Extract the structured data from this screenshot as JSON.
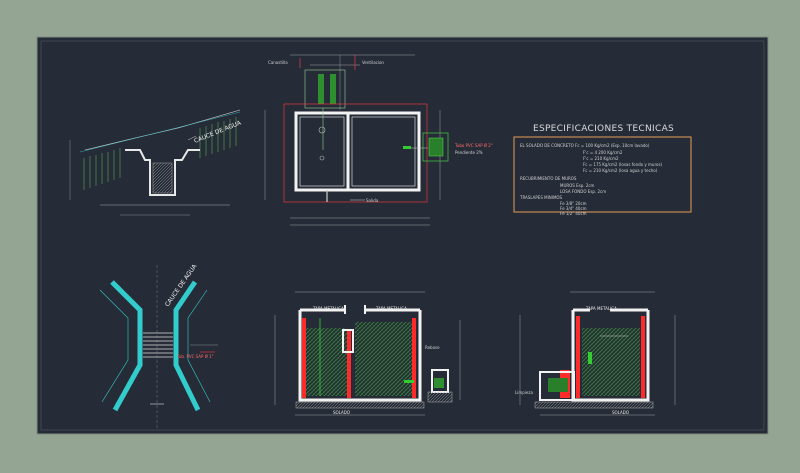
{
  "spec": {
    "title": "ESPECIFICACIONES TECNICAS",
    "rows": [
      "EL SOLADO DE CONCRETO   Fc = 100  Kg/cm2 (Esp. 10cm lavado)",
      "F'c = 4 200  Kg/cm2",
      "F'c = 210   Kg/cm2",
      "Fc = 175  Kg/cm2 (losas fondo y muros)",
      "Fc = 210  Kg/cm2 (losa agua y techo)",
      "RECUBRIMIENTO DE MUROS",
      "MUROS      Esp. 2cm",
      "LOSA FONDO  Esp. 2cm",
      "TRASLAPES MINIMOS",
      "Fe  3/8\"   20cm",
      "Fe  3/4\"   40cm",
      "Fe  1/2\"   40cm"
    ]
  },
  "cauce_label_top": "CAUCE DE AGUA",
  "cauce_label_bottom": "CAUCE DE AGUA",
  "solado_label": "SOLADO",
  "tapa_label": "TAPA METALICA",
  "section_notes": {
    "note1": "Tubo PVC SAP Ø 2\"",
    "note2": "Pendiente 2%",
    "note3": "Canastilla",
    "note4": "Tub. PVC SAP Ø 1\"",
    "note5": "Ventilacion",
    "note6": "Rebose",
    "note7": "Salida",
    "note8": "Limpieza"
  }
}
